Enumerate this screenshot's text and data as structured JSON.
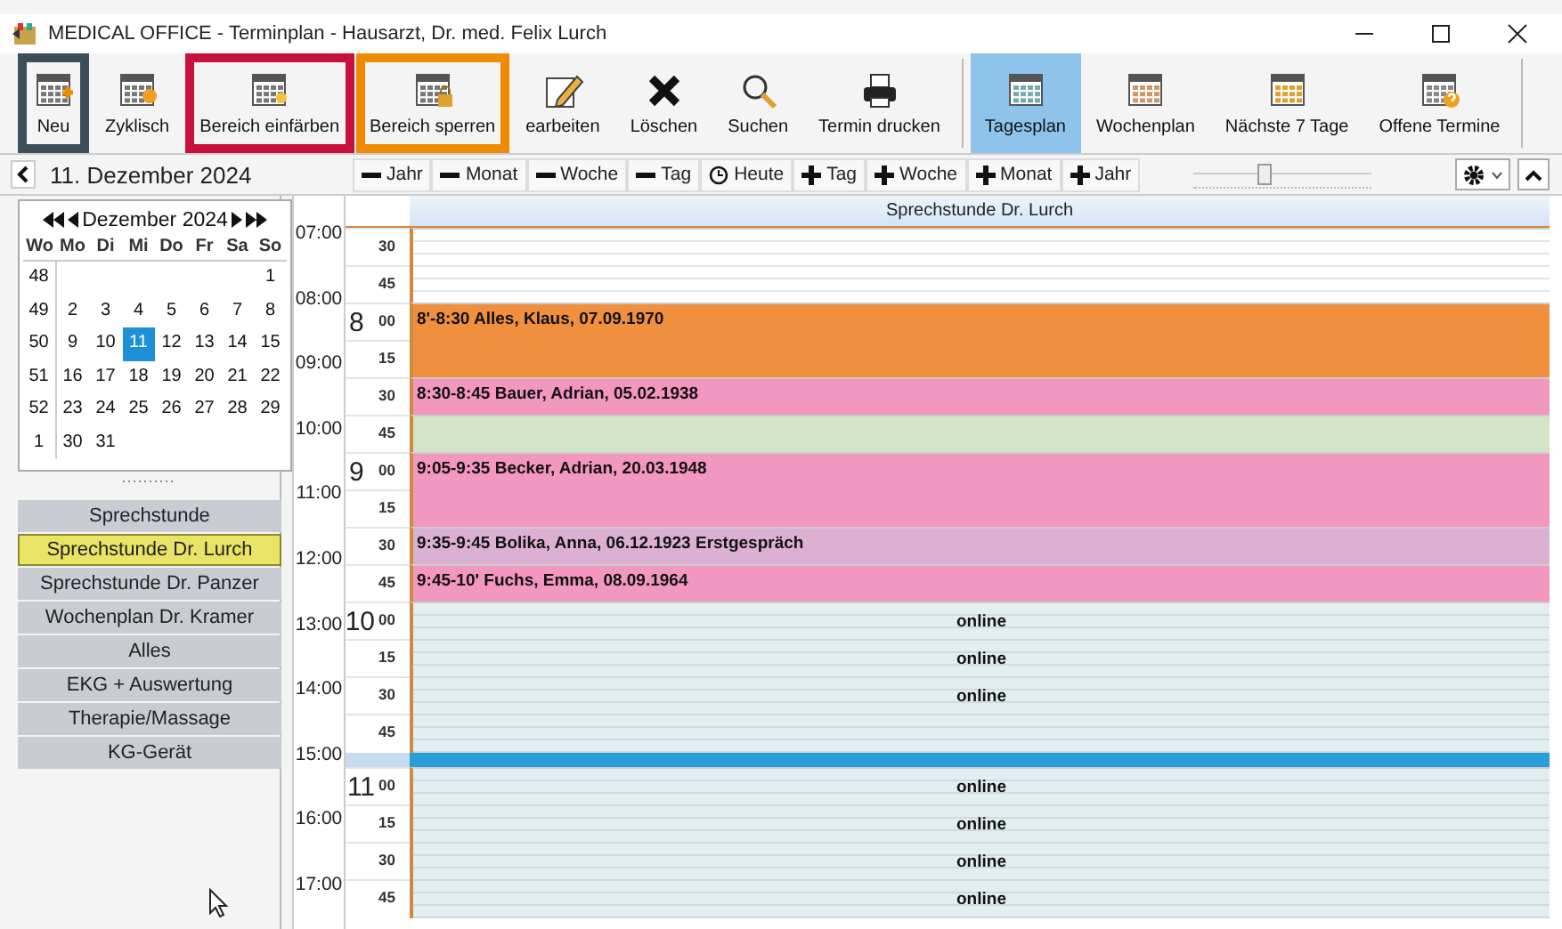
{
  "window": {
    "title": "MEDICAL OFFICE - Terminplan - Hausarzt, Dr. med. Felix Lurch"
  },
  "toolbar": [
    {
      "items": [
        {
          "kind": "new",
          "label": "Neu",
          "color": "#3b4f5a"
        },
        {
          "kind": "cyclic",
          "label": "Zyklisch"
        },
        {
          "kind": "color",
          "label": "Bereich einfärben",
          "color": "#c8103c"
        },
        {
          "kind": "lock",
          "label": "Bereich sperren",
          "color": "#f08a00"
        },
        {
          "kind": "edit",
          "label": "earbeiten"
        },
        {
          "kind": "delete",
          "label": "Löschen"
        },
        {
          "kind": "search",
          "label": "Suchen"
        },
        {
          "kind": "print",
          "label": "Termin drucken"
        }
      ]
    },
    {
      "items": [
        {
          "kind": "view-day",
          "label": "Tagesplan",
          "selected": true
        },
        {
          "kind": "view-week",
          "label": "Wochenplan",
          "selected": false
        },
        {
          "kind": "view-next",
          "label": "Nächste 7 Tage",
          "selected": false
        },
        {
          "kind": "view-open",
          "label": "Offene Termine",
          "selected": false
        }
      ]
    }
  ],
  "date_nav": {
    "date": "11. Dezember 2024"
  },
  "step_buttons": [
    {
      "kind": "minus",
      "label": "Jahr"
    },
    {
      "kind": "minus",
      "label": "Monat"
    },
    {
      "kind": "minus",
      "label": "Woche"
    },
    {
      "kind": "minus",
      "label": "Tag"
    },
    {
      "kind": "today",
      "label": "Heute"
    },
    {
      "kind": "plus",
      "label": "Tag"
    },
    {
      "kind": "plus",
      "label": "Woche"
    },
    {
      "kind": "plus",
      "label": "Monat"
    },
    {
      "kind": "plus",
      "label": "Jahr"
    }
  ],
  "zoom_slider": {
    "level": 0.4
  },
  "mini_calendar": {
    "month": "Dezember 2024",
    "weekdays": [
      "Wo",
      "Mo",
      "Di",
      "Mi",
      "Do",
      "Fr",
      "Sa",
      "So"
    ],
    "weeks": [
      {
        "number": "48",
        "days": [
          {
            "day": "1",
            "selected": false
          }
        ]
      },
      {
        "number": "49",
        "days": [
          {
            "day": "2",
            "selected": false
          },
          {
            "day": "3",
            "selected": false
          },
          {
            "day": "4",
            "selected": false
          },
          {
            "day": "5",
            "selected": false
          },
          {
            "day": "6",
            "selected": false
          },
          {
            "day": "7",
            "selected": false
          },
          {
            "day": "8",
            "selected": false
          }
        ]
      },
      {
        "number": "50",
        "days": [
          {
            "day": "9",
            "selected": false
          },
          {
            "day": "10",
            "selected": false
          },
          {
            "day": "11",
            "selected": true
          },
          {
            "day": "12",
            "selected": false
          },
          {
            "day": "13",
            "selected": false
          },
          {
            "day": "14",
            "selected": false
          },
          {
            "day": "15",
            "selected": false
          }
        ]
      },
      {
        "number": "51",
        "days": [
          {
            "day": "16",
            "selected": false
          },
          {
            "day": "17",
            "selected": false
          },
          {
            "day": "18",
            "selected": false
          },
          {
            "day": "19",
            "selected": false
          },
          {
            "day": "20",
            "selected": false
          },
          {
            "day": "21",
            "selected": false
          },
          {
            "day": "22",
            "selected": false
          }
        ]
      },
      {
        "number": "52",
        "days": [
          {
            "day": "23",
            "selected": false
          },
          {
            "day": "24",
            "selected": false
          },
          {
            "day": "25",
            "selected": false
          },
          {
            "day": "26",
            "selected": false
          },
          {
            "day": "27",
            "selected": false
          },
          {
            "day": "28",
            "selected": false
          },
          {
            "day": "29",
            "selected": false
          }
        ]
      },
      {
        "number": "1",
        "days": [
          {
            "day": "30",
            "selected": false
          },
          {
            "day": "31",
            "selected": false
          }
        ]
      }
    ]
  },
  "schedules": [
    {
      "label": "Sprechstunde",
      "selected": false
    },
    {
      "label": "Sprechstunde Dr. Lurch",
      "selected": true
    },
    {
      "label": "Sprechstunde Dr. Panzer",
      "selected": false
    },
    {
      "label": "Wochenplan Dr. Kramer",
      "selected": false
    },
    {
      "label": "Alles",
      "selected": false
    },
    {
      "label": "EKG + Auswertung",
      "selected": false
    },
    {
      "label": "Therapie/Massage",
      "selected": false
    },
    {
      "label": "KG-Gerät",
      "selected": false
    }
  ],
  "day_view": {
    "column_title": "Sprechstunde Dr. Lurch",
    "time_ruler": [
      "07:00",
      "08:00",
      "09:00",
      "10:00",
      "11:00",
      "12:00",
      "13:00",
      "14:00",
      "15:00",
      "16:00",
      "17:00"
    ],
    "blocks": [
      {
        "kind": "free",
        "slots": [
          {
            "minute": "30"
          },
          {
            "minute": "45"
          }
        ]
      },
      {
        "kind": "appointment",
        "color": "#f0903f",
        "text": "8'-8:30 Alles, Klaus, 07.09.1970",
        "slots": [
          {
            "hour": "8",
            "minute": "00"
          },
          {
            "minute": "15"
          }
        ]
      },
      {
        "kind": "appointment",
        "color": "#f297bf",
        "text": "8:30-8:45 Bauer, Adrian, 05.02.1938",
        "slots": [
          {
            "minute": "30"
          }
        ]
      },
      {
        "kind": "appointment",
        "color": "#d4e4c8",
        "slots": [
          {
            "minute": "45"
          }
        ]
      },
      {
        "kind": "appointment",
        "color": "#f297bf",
        "text": "9:05-9:35 Becker, Adrian, 20.03.1948",
        "slots": [
          {
            "hour": "9",
            "minute": "00"
          },
          {
            "minute": "15"
          }
        ]
      },
      {
        "kind": "appointment",
        "color": "#dcb0d2",
        "text": "9:35-9:45 Bolika, Anna, 06.12.1923 Erstgespräch",
        "slots": [
          {
            "minute": "30"
          }
        ]
      },
      {
        "kind": "appointment",
        "color": "#f297bf",
        "text": "9:45-10' Fuchs, Emma, 08.09.1964",
        "slots": [
          {
            "minute": "45"
          }
        ]
      },
      {
        "kind": "online",
        "slots": [
          {
            "hour": "10",
            "minute": "00",
            "text": "online"
          },
          {
            "minute": "15",
            "text": "online"
          },
          {
            "minute": "30",
            "text": "online"
          },
          {
            "minute": "45"
          }
        ]
      },
      {
        "kind": "marker"
      },
      {
        "kind": "online",
        "slots": [
          {
            "hour": "11",
            "minute": "00",
            "text": "online"
          },
          {
            "minute": "15",
            "text": "online"
          },
          {
            "minute": "30",
            "text": "online"
          },
          {
            "minute": "45",
            "text": "online"
          }
        ]
      }
    ]
  }
}
